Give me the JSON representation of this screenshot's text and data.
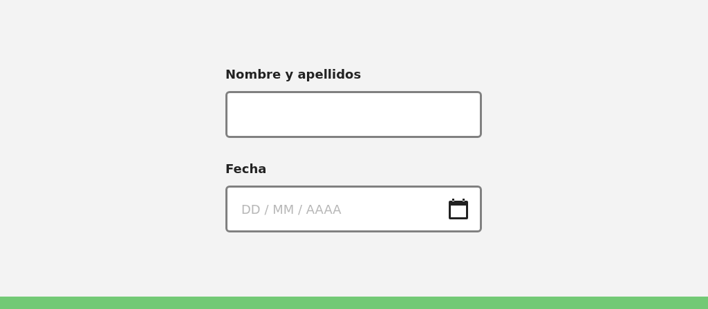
{
  "fields": [
    {
      "kind": "text",
      "label": "Nombre y apellidos"
    },
    {
      "kind": "date",
      "label": "Fecha",
      "placeholder": "DD / MM / AAAA"
    }
  ]
}
